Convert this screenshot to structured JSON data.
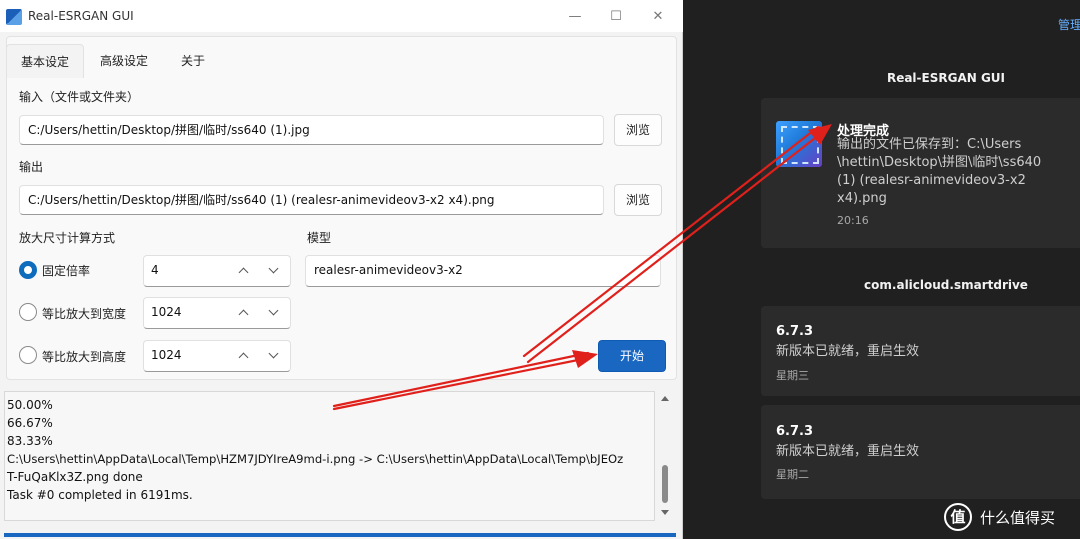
{
  "window": {
    "title": "Real-ESRGAN GUI",
    "controls": {
      "minimize": "—",
      "maximize": "☐",
      "close": "✕"
    }
  },
  "tabs": [
    "基本设定",
    "高级设定",
    "关于"
  ],
  "input": {
    "label": "输入（文件或文件夹）",
    "value": "C:/Users/hettin/Desktop/拼图/临时/ss640 (1).jpg",
    "browse": "浏览"
  },
  "output": {
    "label": "输出",
    "value": "C:/Users/hettin/Desktop/拼图/临时/ss640 (1) (realesr-animevideov3-x2 x4).png",
    "browse": "浏览"
  },
  "scale": {
    "label": "放大尺寸计算方式",
    "options": [
      {
        "label": "固定倍率",
        "value": "4",
        "selected": true
      },
      {
        "label": "等比放大到宽度",
        "value": "1024",
        "selected": false
      },
      {
        "label": "等比放大到高度",
        "value": "1024",
        "selected": false
      }
    ]
  },
  "model": {
    "label": "模型",
    "value": "realesr-animevideov3-x2"
  },
  "start_button": "开始",
  "log": [
    "50.00%",
    "66.67%",
    "83.33%",
    "C:\\Users\\hettin\\AppData\\Local\\Temp\\HZM7JDYIreA9md-i.png -> C:\\Users\\hettin\\AppData\\Local\\Temp\\bJEOz",
    "T-FuQaKlx3Z.png done",
    "Task #0 completed in 6191ms."
  ],
  "progress": 1.0,
  "notification_center": {
    "manage": "管理",
    "groups": [
      {
        "app": "Real-ESRGAN GUI",
        "notifications": [
          {
            "title": "处理完成",
            "body": [
              "输出的文件已保存到：C:\\Users",
              "\\hettin\\Desktop\\拼图\\临时\\ss640",
              "(1) (realesr-animevideov3-x2",
              "x4).png"
            ],
            "time": "20:16"
          }
        ]
      },
      {
        "app": "com.alicloud.smartdrive",
        "notifications": [
          {
            "title": "6.7.3",
            "body": [
              "新版本已就绪，重启生效"
            ],
            "time": "星期三"
          },
          {
            "title": "6.7.3",
            "body": [
              "新版本已就绪，重启生效"
            ],
            "time": "星期二"
          }
        ]
      }
    ]
  },
  "watermark": {
    "logo": "值",
    "text": "什么值得买"
  },
  "colors": {
    "accent": "#1a67c2",
    "arrow": "#e0201b",
    "dark_bg": "#202020",
    "card_bg": "#2b2b2b"
  },
  "icons": [
    "app-icon",
    "image-icon"
  ]
}
